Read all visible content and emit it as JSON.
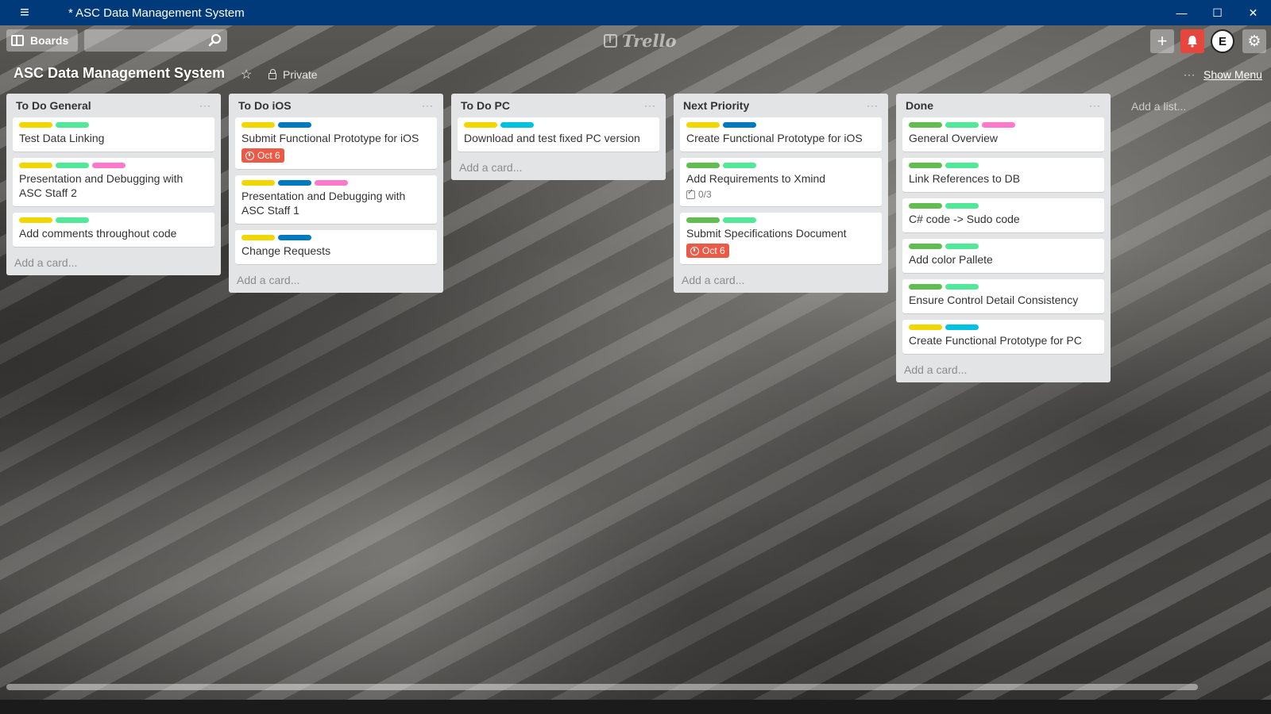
{
  "window": {
    "title": "* ASC Data Management System",
    "menu_icon": "hamburger-icon",
    "controls": [
      "minimize",
      "maximize",
      "close"
    ]
  },
  "header": {
    "boards_label": "Boards",
    "search_value": "",
    "logo_text": "Trello"
  },
  "board": {
    "title": "ASC Data Management System",
    "visibility": "Private",
    "show_menu_label": "Show Menu",
    "add_list_label": "Add a list..."
  },
  "label_colors": {
    "yellow": "#f2d600",
    "green": "#61bd4f",
    "mint": "#51e898",
    "blue": "#0079bf",
    "sky": "#00c2e0",
    "pink": "#ff78cb"
  },
  "lists": [
    {
      "name": "To Do General",
      "add_card_label": "Add a card...",
      "cards": [
        {
          "title": "Test Data Linking",
          "labels": [
            "yellow",
            "mint"
          ]
        },
        {
          "title": "Presentation and Debugging with ASC Staff 2",
          "labels": [
            "yellow",
            "mint",
            "pink"
          ]
        },
        {
          "title": "Add comments throughout code",
          "labels": [
            "yellow",
            "mint"
          ]
        }
      ]
    },
    {
      "name": "To Do iOS",
      "add_card_label": "Add a card...",
      "cards": [
        {
          "title": "Submit Functional Prototype for iOS",
          "labels": [
            "yellow",
            "blue"
          ],
          "due": "Oct 6"
        },
        {
          "title": "Presentation and Debugging with ASC Staff 1",
          "labels": [
            "yellow",
            "blue",
            "pink"
          ]
        },
        {
          "title": "Change Requests",
          "labels": [
            "yellow",
            "blue"
          ]
        }
      ]
    },
    {
      "name": "To Do PC",
      "add_card_label": "Add a card...",
      "cards": [
        {
          "title": "Download and test fixed PC version",
          "labels": [
            "yellow",
            "sky"
          ]
        }
      ]
    },
    {
      "name": "Next Priority",
      "add_card_label": "Add a card...",
      "cards": [
        {
          "title": "Create Functional Prototype for iOS",
          "labels": [
            "yellow",
            "blue"
          ]
        },
        {
          "title": "Add Requirements to Xmind",
          "labels": [
            "green",
            "mint"
          ],
          "checklist": "0/3"
        },
        {
          "title": "Submit Specifications Document",
          "labels": [
            "green",
            "mint"
          ],
          "due": "Oct 6"
        }
      ]
    },
    {
      "name": "Done",
      "add_card_label": "Add a card...",
      "cards": [
        {
          "title": "General Overview",
          "labels": [
            "green",
            "mint",
            "pink"
          ]
        },
        {
          "title": "Link References to DB",
          "labels": [
            "green",
            "mint"
          ]
        },
        {
          "title": "C# code -> Sudo code",
          "labels": [
            "green",
            "mint"
          ]
        },
        {
          "title": "Add color Pallete",
          "labels": [
            "green",
            "mint"
          ]
        },
        {
          "title": "Ensure Control Detail Consistency",
          "labels": [
            "green",
            "mint"
          ]
        },
        {
          "title": "Create Functional Prototype for PC",
          "labels": [
            "yellow",
            "sky"
          ]
        }
      ]
    }
  ]
}
